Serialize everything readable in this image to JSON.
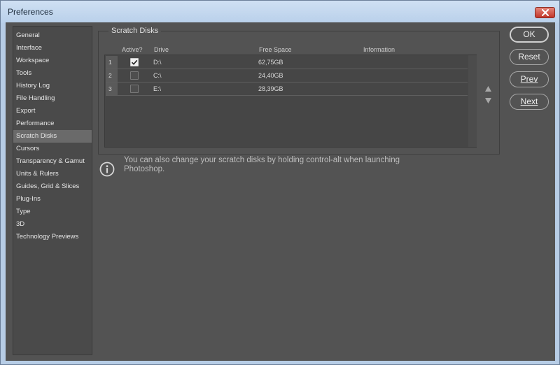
{
  "window": {
    "title": "Preferences",
    "close_icon": "close-icon"
  },
  "sidebar": {
    "items": [
      {
        "label": "General"
      },
      {
        "label": "Interface"
      },
      {
        "label": "Workspace"
      },
      {
        "label": "Tools"
      },
      {
        "label": "History Log"
      },
      {
        "label": "File Handling"
      },
      {
        "label": "Export"
      },
      {
        "label": "Performance"
      },
      {
        "label": "Scratch Disks",
        "selected": true
      },
      {
        "label": "Cursors"
      },
      {
        "label": "Transparency & Gamut"
      },
      {
        "label": "Units & Rulers"
      },
      {
        "label": "Guides, Grid & Slices"
      },
      {
        "label": "Plug-Ins"
      },
      {
        "label": "Type"
      },
      {
        "label": "3D"
      },
      {
        "label": "Technology Previews"
      }
    ]
  },
  "scratch": {
    "title": "Scratch Disks",
    "columns": {
      "active": "Active?",
      "drive": "Drive",
      "free": "Free Space",
      "info": "Information"
    },
    "rows": [
      {
        "num": "1",
        "active": true,
        "drive": "D:\\",
        "free": "62,75GB",
        "info": ""
      },
      {
        "num": "2",
        "active": false,
        "drive": "C:\\",
        "free": "24,40GB",
        "info": ""
      },
      {
        "num": "3",
        "active": false,
        "drive": "E:\\",
        "free": "28,39GB",
        "info": ""
      }
    ],
    "move_up_icon": "triangle-up-icon",
    "move_down_icon": "triangle-down-icon"
  },
  "message": {
    "icon": "info-icon",
    "text": "You can also change your scratch disks by holding control-alt when launching Photoshop."
  },
  "buttons": {
    "ok": "OK",
    "reset": "Reset",
    "prev": "Prev",
    "next": "Next"
  },
  "colors": {
    "panel": "#535353",
    "title_bar": "#b9d0ea",
    "close_button": "#c2352a",
    "selected_item": "#6a6a6a"
  }
}
